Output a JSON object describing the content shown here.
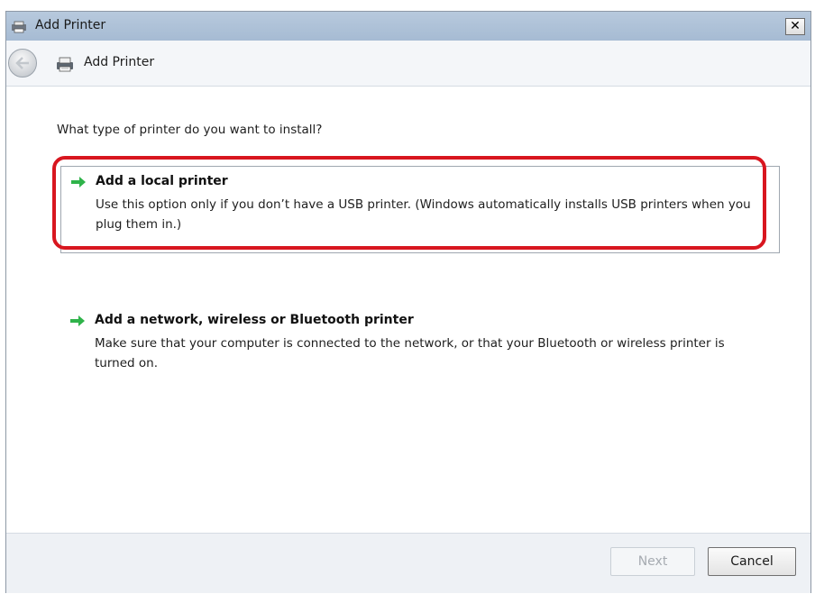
{
  "window": {
    "title": "Add Printer",
    "close_label": "✕"
  },
  "nav": {
    "title": "Add Printer"
  },
  "content": {
    "question": "What type of printer do you want to install?",
    "options": [
      {
        "title": "Add a local printer",
        "description": "Use this option only if you don’t have a USB printer. (Windows automatically installs USB printers when you plug them in.)",
        "highlighted": true
      },
      {
        "title": "Add a network, wireless or Bluetooth printer",
        "description": "Make sure that your computer is connected to the network, or that your Bluetooth or wireless printer is turned on.",
        "highlighted": false
      }
    ]
  },
  "footer": {
    "next_label": "Next",
    "next_enabled": false,
    "cancel_label": "Cancel"
  },
  "colors": {
    "highlight": "#d8161f",
    "arrow": "#2fb34a",
    "titlebar": "#aebfd5"
  },
  "icons": [
    "printer-icon",
    "back-arrow-icon",
    "green-arrow-icon",
    "close-icon"
  ]
}
